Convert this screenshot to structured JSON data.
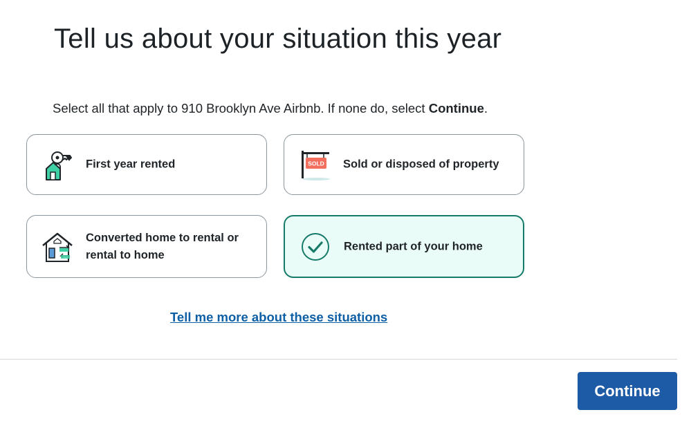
{
  "page": {
    "title": "Tell us about your situation this year",
    "instruction_prefix": "Select all that apply to 910 Brooklyn Ave Airbnb. If none do, select ",
    "instruction_bold": "Continue",
    "instruction_suffix": "."
  },
  "options": [
    {
      "label": "First year rented",
      "icon": "house-key-icon",
      "selected": false
    },
    {
      "label": "Sold or disposed of property",
      "icon": "sold-sign-icon",
      "icon_text": "SOLD",
      "selected": false
    },
    {
      "label": "Converted home to rental or rental to home",
      "icon": "house-convert-icon",
      "selected": false
    },
    {
      "label": "Rented part of your home",
      "icon": "checkmark-icon",
      "selected": true
    }
  ],
  "link": {
    "label": "Tell me more about these situations"
  },
  "footer": {
    "continue_label": "Continue"
  },
  "colors": {
    "selected_border": "#157a68",
    "selected_bg": "#eafcf7",
    "link": "#0d5fa6",
    "primary_button": "#1d5ba6",
    "icon_teal": "#3fd1a5",
    "sold_red": "#f26f5e"
  }
}
